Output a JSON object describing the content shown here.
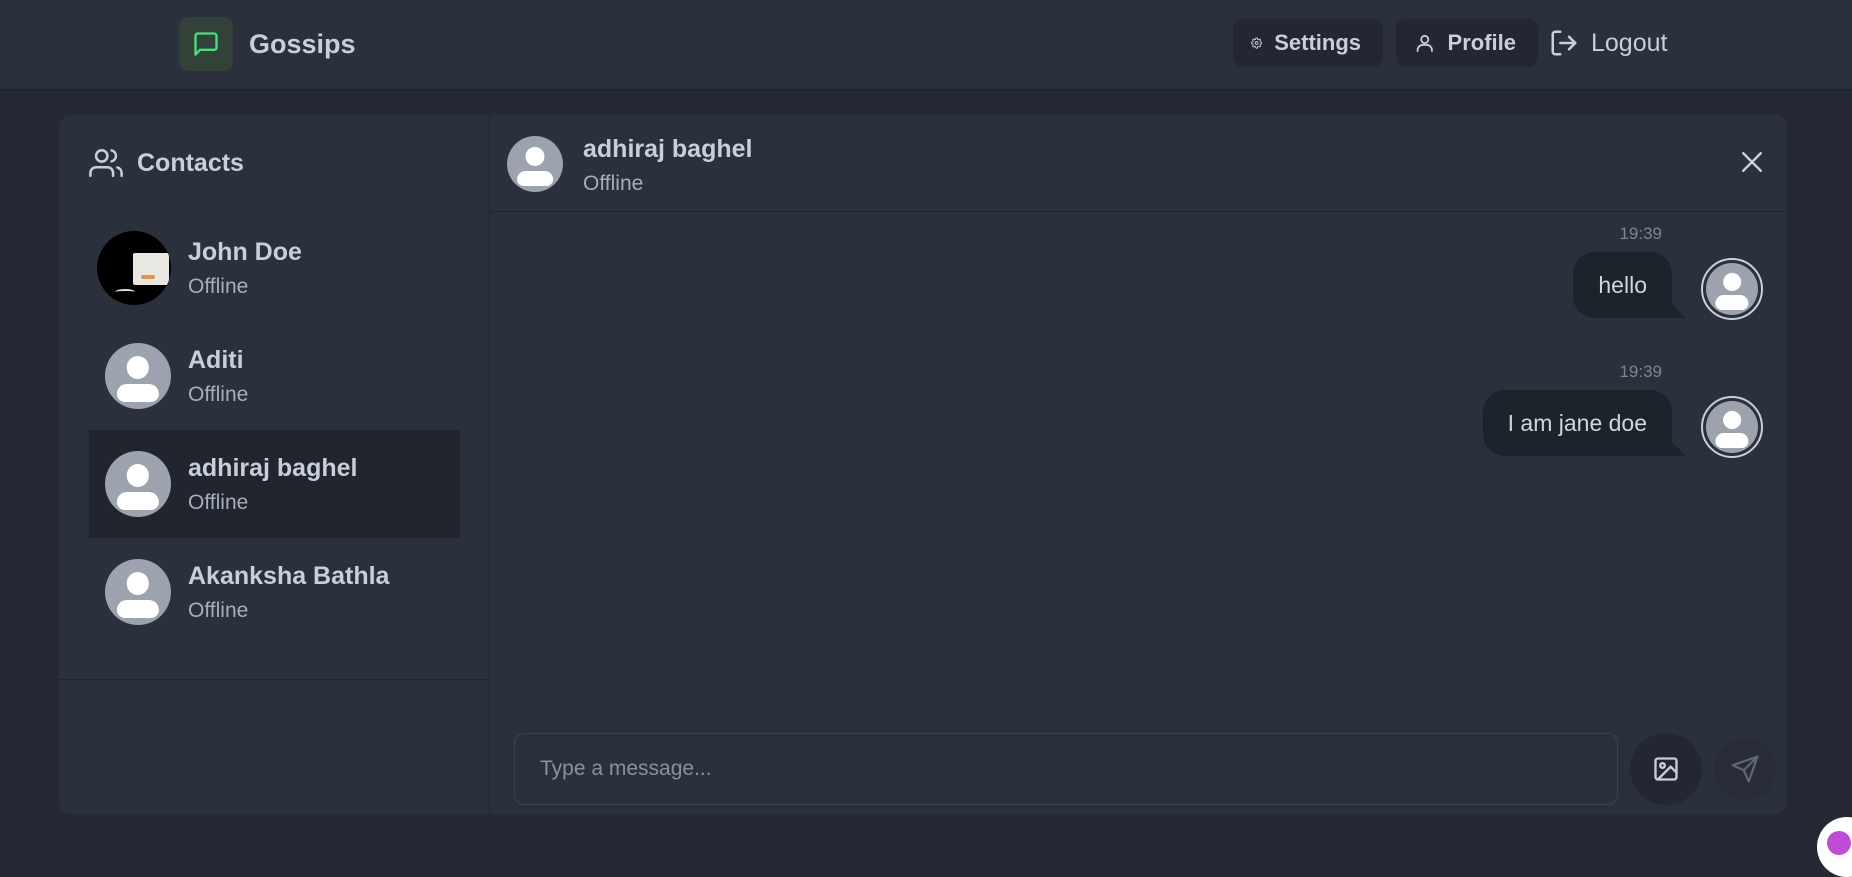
{
  "app": {
    "name": "Gossips"
  },
  "nav": {
    "settings_label": "Settings",
    "profile_label": "Profile",
    "logout_label": "Logout"
  },
  "sidebar": {
    "title": "Contacts",
    "contacts": [
      {
        "name": "John Doe",
        "status": "Offline",
        "avatar": "photo"
      },
      {
        "name": "Aditi",
        "status": "Offline",
        "avatar": "default"
      },
      {
        "name": "adhiraj baghel",
        "status": "Offline",
        "avatar": "default",
        "selected": true
      },
      {
        "name": "Akanksha Bathla",
        "status": "Offline",
        "avatar": "default"
      }
    ]
  },
  "chat": {
    "contact_name": "adhiraj baghel",
    "contact_status": "Offline",
    "messages": [
      {
        "time": "19:39",
        "text": "hello",
        "own": true
      },
      {
        "time": "19:39",
        "text": "I am jane doe",
        "own": true
      }
    ]
  },
  "composer": {
    "placeholder": "Type a message...",
    "value": ""
  },
  "icons": {
    "logo": "message-square-icon",
    "settings": "gear-icon",
    "profile": "user-icon",
    "logout": "logout-icon",
    "contacts": "users-icon",
    "close": "close-icon",
    "image": "image-icon",
    "send": "send-icon"
  },
  "colors": {
    "background": "#242933",
    "surface": "#2a303c",
    "accent_green": "#4ade80",
    "text": "#c8cfda"
  }
}
